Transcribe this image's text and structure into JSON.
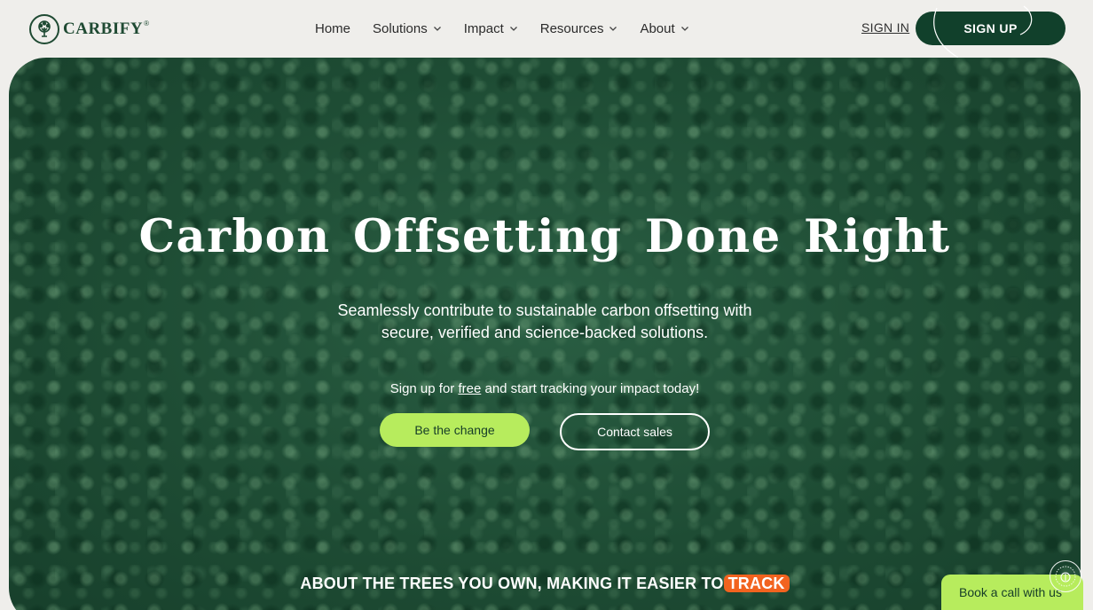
{
  "brand": {
    "name": "CARBIFY",
    "reg_mark": "®",
    "primary_color": "#11402b",
    "accent_color": "#b7ec5d",
    "highlight_color": "#f2631f"
  },
  "nav": {
    "items": [
      {
        "label": "Home",
        "has_dropdown": false
      },
      {
        "label": "Solutions",
        "has_dropdown": true
      },
      {
        "label": "Impact",
        "has_dropdown": true
      },
      {
        "label": "Resources",
        "has_dropdown": true
      },
      {
        "label": "About",
        "has_dropdown": true
      }
    ],
    "sign_in": "SIGN IN",
    "sign_up": "SIGN UP"
  },
  "hero": {
    "title": "Carbon Offsetting Done Right",
    "subtitle": "Seamlessly contribute to sustainable carbon offsetting with secure, verified and science-backed solutions.",
    "cta_prefix": "Sign up for",
    "cta_link": "free",
    "cta_suffix": "and start tracking your impact today!",
    "primary_button": "Be the change",
    "secondary_button": "Contact sales",
    "ticker_text": "ABOUT THE TREES YOU OWN, MAKING IT EASIER TO",
    "ticker_highlight": "TRACK"
  },
  "floating": {
    "book_call": "Book a call with us",
    "badge_icon": "carbify-seal-icon"
  }
}
